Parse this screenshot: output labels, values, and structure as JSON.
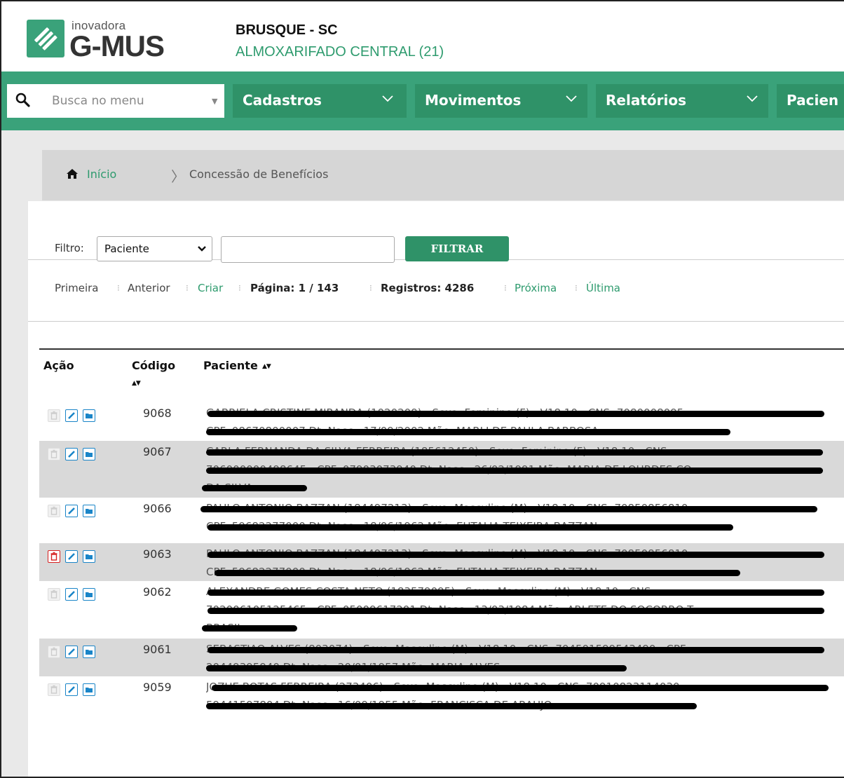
{
  "header": {
    "logo_small": "inovadora",
    "logo_big": "G-MUS",
    "city": "BRUSQUE - SC",
    "unit": "ALMOXARIFADO CENTRAL (21)"
  },
  "nav": {
    "search_placeholder": "Busca no menu",
    "menus": [
      "Cadastros",
      "Movimentos",
      "Relatórios",
      "Pacien"
    ]
  },
  "breadcrumb": {
    "home": "Início",
    "current": "Concessão de Benefícios"
  },
  "filter": {
    "label": "Filtro:",
    "selected": "Paciente",
    "value": "",
    "button": "FILTRAR"
  },
  "pager": {
    "first": "Primeira",
    "prev": "Anterior",
    "create": "Criar",
    "page": "Página: 1 / 143",
    "records": "Registros: 4286",
    "next": "Próxima",
    "last": "Última"
  },
  "table": {
    "headers": [
      "Ação",
      "Código",
      "Paciente"
    ],
    "rows": [
      {
        "code": "9068",
        "deletable": false,
        "lines": [
          "GABRIELA CRISTINE MIRANDA (1020209) - Sexo: Feminino (F) - V18.10 - CNS: 7080008095",
          "CPF: 08670800007 Dt. Nasc.: 17/09/2002 Mãe: MARLI DE PAULA BARBOSA"
        ]
      },
      {
        "code": "9067",
        "deletable": false,
        "lines": [
          "CARLA FERNANDA DA SILVA FERREIRA (185612450) - Sexo: Feminino (F) - V18.10 - CNS:",
          "706000000498645 - CPF: 07903073940 Dt. Nasc.: 26/02/1991 Mãe: MARIA DE LOURDES CO",
          "DA SILVA"
        ]
      },
      {
        "code": "9066",
        "deletable": false,
        "lines": [
          "PAULO ANTONIO BAZZAN (184497213) - Sexo: Masculino (M) - V18.10 - CNS: 70850856810",
          "CPF: 59682277000 Dt. Nasc.: 18/06/1962 Mãe: EUTALIA TEIXEIRA BAZZAN"
        ]
      },
      {
        "code": "9063",
        "deletable": true,
        "lines": [
          "PAULO ANTONIO BAZZAN (184497213) - Sexo: Masculino (M) - V18.10 - CNS: 70850856810",
          "CPF: 59682277000 Dt. Nasc.: 18/06/1962 Mãe: EUTALIA TEIXEIRA BAZZAN"
        ]
      },
      {
        "code": "9062",
        "deletable": false,
        "lines": [
          "ALEXANDRE GOMES COSTA NETO (183579095) - Sexo: Masculino (M) - V18.10 - CNS:",
          "702006105125465 - CPF: 05009617201 Dt. Nasc.: 13/03/1984 Mãe: ARLETE DO SOCORRO T",
          "BRASIL"
        ]
      },
      {
        "code": "9061",
        "deletable": false,
        "lines": [
          "SEBASTIAO ALVES (803074) - Sexo: Masculino (M) - V18.10 - CNS: 704501599543490 - CPF",
          "20449395940 Dt. Nasc.: 20/01/1957 Mãe: MARIA ALVES"
        ]
      },
      {
        "code": "9059",
        "deletable": false,
        "lines": [
          "JOZUE BOTAS FERREIRA (273406) - Sexo: Masculino (M) - V18.10 - CNS: 70910823114030",
          "59441597804 Dt. Nasc.: 16/09/1955 Mãe: FRANCISCA DE ARAUJO"
        ]
      }
    ]
  }
}
